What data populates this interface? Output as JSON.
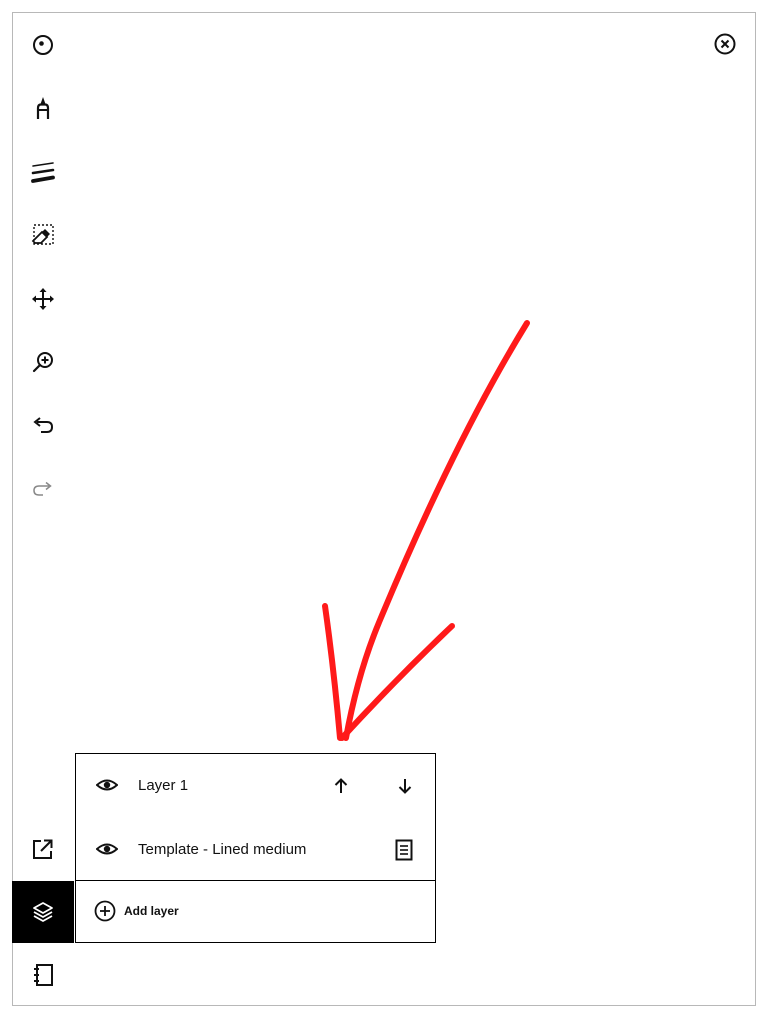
{
  "toolbar": {
    "tools": [
      {
        "icon": "circle-dot-icon"
      },
      {
        "icon": "marker-pen-icon"
      },
      {
        "icon": "stroke-width-icon"
      },
      {
        "icon": "selection-eraser-icon"
      },
      {
        "icon": "move-icon"
      },
      {
        "icon": "zoom-in-icon"
      },
      {
        "icon": "undo-icon"
      },
      {
        "icon": "redo-icon"
      },
      {
        "icon": "share-export-icon"
      },
      {
        "icon": "layers-icon"
      },
      {
        "icon": "notebook-icon"
      }
    ],
    "active_tool": "layers-icon"
  },
  "close": {
    "icon": "close-circle-icon"
  },
  "layers_panel": {
    "layers": [
      {
        "name": "Layer 1",
        "visible": true
      },
      {
        "name": "Template - Lined medium",
        "visible": true
      }
    ],
    "add_layer_label": "Add layer"
  },
  "colors": {
    "active_background": "#000000",
    "annotation_arrow": "#ff0000",
    "frame_border": "#b8b8b8"
  }
}
